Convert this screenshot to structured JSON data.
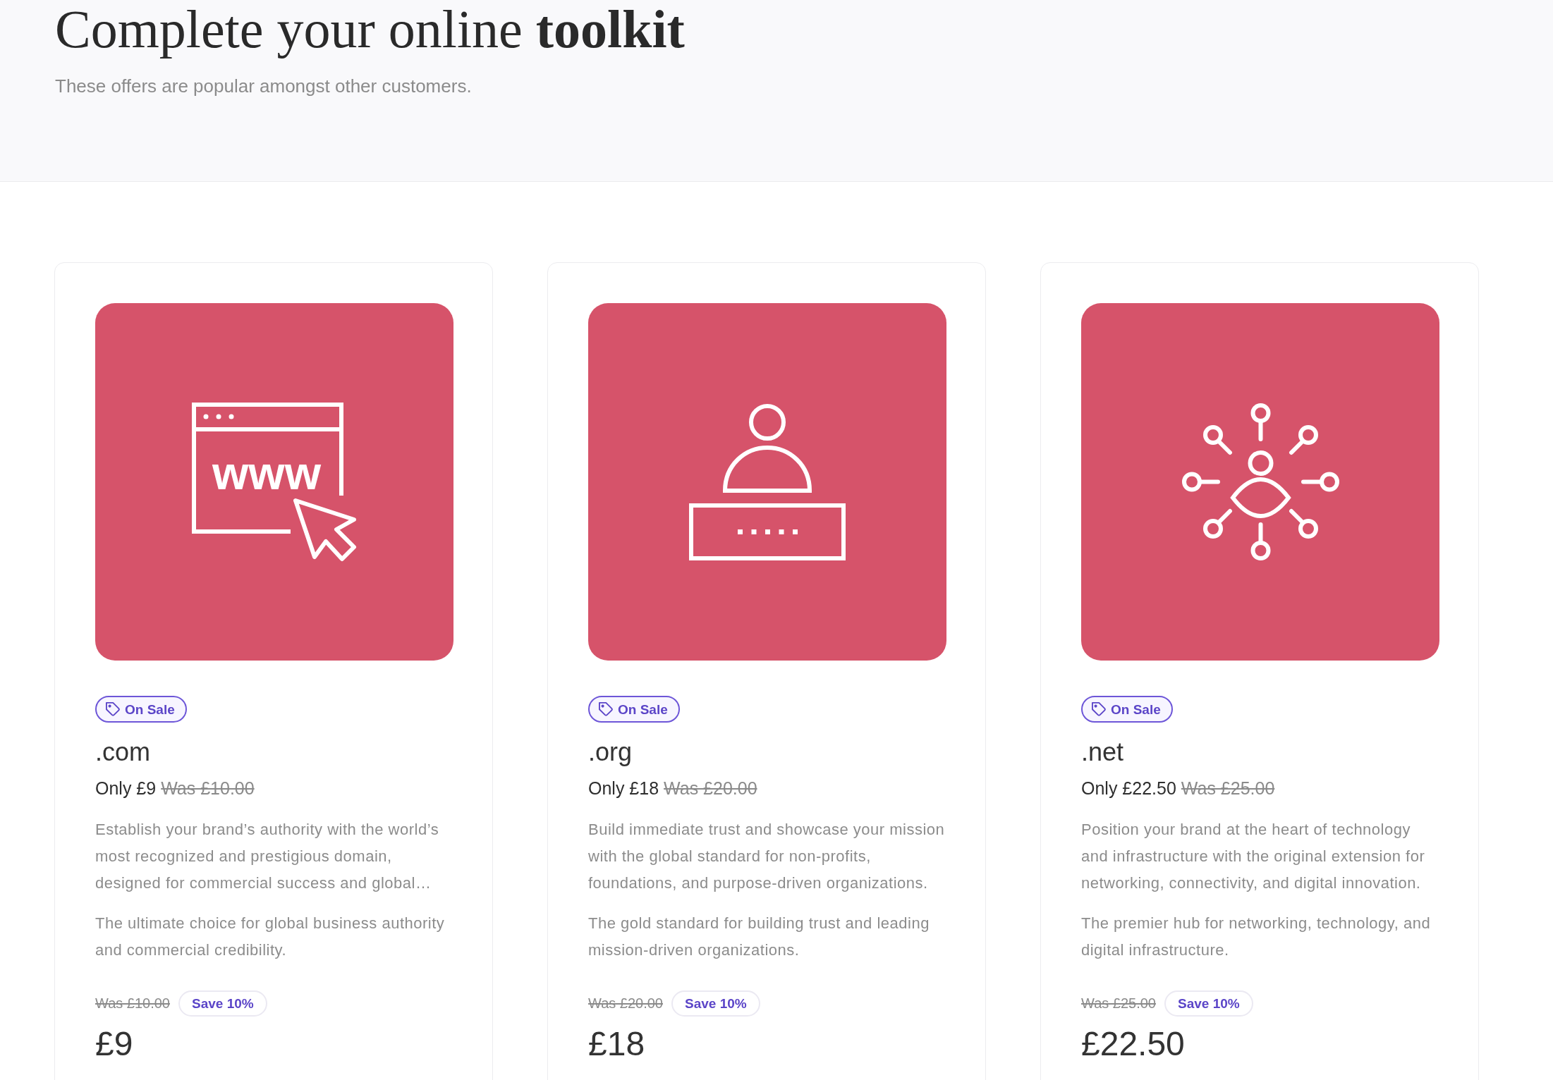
{
  "header": {
    "title": "Complete your online **toolkit**",
    "subtitle": "These offers are popular amongst other customers."
  },
  "cards": [
    {
      "illustration": {
        "kind": "browser",
        "text": "www"
      },
      "badge": "On Sale",
      "name": ".com",
      "offer": "Only £9",
      "offer_was": "Was £10.00",
      "description": "Establish your brand’s authority with the world’s most recognized and prestigious domain, designed for commercial success and global…",
      "tagline": "The ultimate choice for global business authority and commercial credibility.",
      "was_price": "Was £10.00",
      "savings": "Save 10%",
      "price": "£9"
    },
    {
      "illustration": {
        "kind": "user-login"
      },
      "badge": "On Sale",
      "name": ".org",
      "offer": "Only £18",
      "offer_was": "Was £20.00",
      "description": "Build immediate trust and showcase your mission with the global standard for non-profits, foundations, and purpose-driven organizations.",
      "tagline": "The gold standard for building trust and leading mission-driven organizations.",
      "was_price": "Was £20.00",
      "savings": "Save 10%",
      "price": "£18"
    },
    {
      "illustration": {
        "kind": "network"
      },
      "badge": "On Sale",
      "name": ".net",
      "offer": "Only £22.50",
      "offer_was": "Was £25.00",
      "description": "Position your brand at the heart of technology and infrastructure with the original extension for networking, connectivity, and digital innovation.",
      "tagline": "The premier hub for networking, technology, and digital infrastructure.",
      "was_price": "Was £25.00",
      "savings": "Save 10%",
      "price": "£22.50"
    }
  ]
}
